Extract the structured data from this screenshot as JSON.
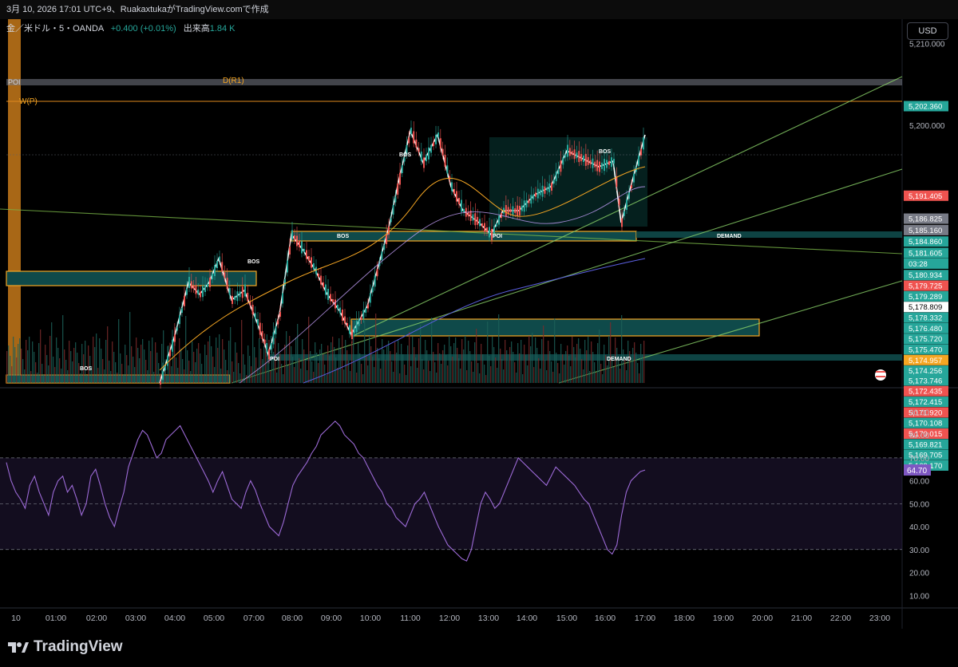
{
  "header": {
    "caption": "3月 10, 2026 17:01 UTC+9、RuakaxtukaがTradingView.comで作成"
  },
  "legend": {
    "symbol": "金／米ドル・5・OANDA",
    "change": "+0.400 (+0.01%)",
    "volume_label": "出来高",
    "volume_value": "1.84 K"
  },
  "currency_button": "USD",
  "brand": "TradingView",
  "colors": {
    "bull": "#26a69a",
    "bear": "#ef5350",
    "zone_fill": "#0f4a4a",
    "zone_border": "#f5a623",
    "rsi_line": "#9c6ad6"
  },
  "chart_data": {
    "type": "candlestick",
    "price_axis": {
      "ticks": [
        "5,210.000",
        "5,200.000"
      ],
      "ylim": [
        5168.5,
        5213
      ]
    },
    "price_labels": [
      {
        "value": "5,202.360",
        "price": 5202.36,
        "color": "#26a69a"
      },
      {
        "value": "5,191.405",
        "price": 5191.405,
        "color": "#ef5350"
      },
      {
        "value": "5,186.825",
        "price": 5188.6,
        "color": "#787b86"
      },
      {
        "value": "5,185.160",
        "price": 5187.2,
        "color": "#787b86"
      },
      {
        "value": "5,184.860",
        "price": 5185.8,
        "color": "#26a69a"
      },
      {
        "value": "5,181.605",
        "price": 5184.4,
        "color": "#26a69a"
      },
      {
        "value": "03:28",
        "price": 5183.1,
        "color": "#26a69a"
      },
      {
        "value": "5,180.934",
        "price": 5181.7,
        "color": "#26a69a"
      },
      {
        "value": "5,179.725",
        "price": 5180.4,
        "color": "#ef5350"
      },
      {
        "value": "5,179.289",
        "price": 5179.1,
        "color": "#26a69a"
      },
      {
        "value": "5,178.809",
        "price": 5177.8,
        "color": "#ffffff"
      },
      {
        "value": "5,178.332",
        "price": 5176.5,
        "color": "#26a69a"
      },
      {
        "value": "5,176.480",
        "price": 5175.2,
        "color": "#26a69a"
      },
      {
        "value": "5,175.720",
        "price": 5173.9,
        "color": "#26a69a"
      },
      {
        "value": "5,175.470",
        "price": 5172.6,
        "color": "#26a69a"
      },
      {
        "value": "5,174.957",
        "price": 5171.3,
        "color": "#f5a623"
      },
      {
        "value": "5,174.256",
        "price": 5170.0,
        "color": "#26a69a"
      },
      {
        "value": "5,173.746",
        "price": 5168.8,
        "color": "#26a69a"
      },
      {
        "value": "5,172.435",
        "price": 5167.5,
        "color": "#ef5350"
      },
      {
        "value": "5,172.415",
        "price": 5166.2,
        "color": "#26a69a"
      },
      {
        "value": "5,171.920",
        "price": 5164.9,
        "color": "#ef5350"
      },
      {
        "value": "5,170.108",
        "price": 5163.6,
        "color": "#26a69a"
      },
      {
        "value": "5,170.015",
        "price": 5162.3,
        "color": "#ef5350"
      },
      {
        "value": "5,169.821",
        "price": 5161.0,
        "color": "#26a69a"
      },
      {
        "value": "5,169.705",
        "price": 5159.7,
        "color": "#26a69a"
      },
      {
        "value": "5,169.170",
        "price": 5158.4,
        "color": "#26a69a"
      }
    ],
    "time_axis": [
      "10",
      "01:00",
      "02:00",
      "03:00",
      "04:00",
      "05:00",
      "07:00",
      "08:00",
      "09:00",
      "10:00",
      "11:00",
      "12:00",
      "13:00",
      "14:00",
      "15:00",
      "16:00",
      "17:00",
      "18:00",
      "19:00",
      "20:00",
      "21:00",
      "22:00",
      "23:00"
    ],
    "zone_labels": [
      "POI",
      "D(R1)",
      "W(P)",
      "BOS",
      "BOS",
      "BOS",
      "BOS",
      "BOS",
      "POI",
      "POI",
      "DEMAND",
      "DEMAND"
    ],
    "rsi": {
      "axis_ticks": [
        "90.00",
        "80.00",
        "70.00",
        "60.00",
        "50.00",
        "40.00",
        "30.00",
        "20.00",
        "10.00"
      ],
      "ylim": [
        8,
        95
      ],
      "last_value": "64.70",
      "last": 64.7,
      "bands": [
        70,
        50,
        30
      ],
      "values": [
        68,
        60,
        55,
        52,
        48,
        58,
        62,
        55,
        50,
        45,
        55,
        60,
        62,
        55,
        58,
        52,
        45,
        50,
        62,
        65,
        58,
        50,
        44,
        40,
        48,
        55,
        66,
        72,
        78,
        82,
        80,
        75,
        70,
        72,
        78,
        80,
        82,
        84,
        80,
        76,
        72,
        68,
        64,
        60,
        55,
        60,
        64,
        58,
        52,
        50,
        48,
        55,
        60,
        56,
        50,
        45,
        40,
        38,
        36,
        42,
        50,
        58,
        62,
        65,
        68,
        72,
        75,
        80,
        82,
        84,
        86,
        84,
        80,
        78,
        76,
        72,
        70,
        66,
        62,
        58,
        55,
        50,
        48,
        44,
        42,
        40,
        45,
        50,
        52,
        55,
        50,
        45,
        40,
        36,
        32,
        30,
        28,
        26,
        25,
        30,
        40,
        50,
        55,
        52,
        48,
        50,
        55,
        60,
        65,
        70,
        68,
        66,
        64,
        62,
        60,
        58,
        62,
        66,
        64,
        62,
        60,
        58,
        55,
        52,
        50,
        45,
        40,
        35,
        30,
        28,
        32,
        45,
        55,
        60,
        62,
        64,
        64.7
      ]
    }
  }
}
